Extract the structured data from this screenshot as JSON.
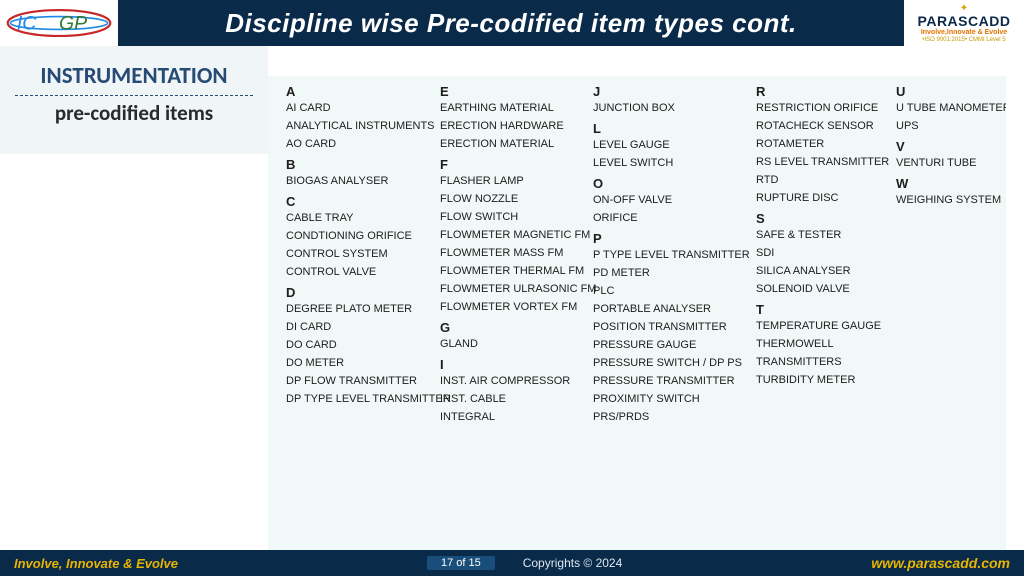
{
  "title": "Discipline wise Pre-codified item types cont.",
  "left_logo": {
    "text1": "IC",
    "text2": "GP"
  },
  "right_logo": {
    "brand": "PARASCADD",
    "tag1": "Involve,Innovate & Evolve",
    "tag2": "•ISO 9001:2015• CMMI Level 5"
  },
  "side": {
    "h1": "INSTRUMENTATION",
    "h2": "pre-codified items"
  },
  "columns": [
    [
      {
        "letter": "A",
        "items": [
          "AI CARD",
          "ANALYTICAL INSTRUMENTS",
          "AO CARD"
        ]
      },
      {
        "letter": "B",
        "items": [
          "BIOGAS ANALYSER"
        ]
      },
      {
        "letter": "C",
        "items": [
          "CABLE TRAY",
          "CONDTIONING ORIFICE",
          "CONTROL SYSTEM",
          "CONTROL VALVE"
        ]
      },
      {
        "letter": "D",
        "items": [
          "DEGREE PLATO METER",
          "DI CARD",
          "DO CARD",
          "DO METER",
          "DP FLOW TRANSMITTER",
          "DP TYPE LEVEL TRANSMITTER"
        ]
      }
    ],
    [
      {
        "letter": "E",
        "items": [
          "EARTHING MATERIAL",
          "ERECTION HARDWARE",
          "ERECTION MATERIAL"
        ]
      },
      {
        "letter": "F",
        "items": [
          "FLASHER LAMP",
          "FLOW NOZZLE",
          "FLOW SWITCH",
          "FLOWMETER MAGNETIC FM",
          "FLOWMETER MASS FM",
          "FLOWMETER THERMAL FM",
          "FLOWMETER ULRASONIC FM",
          "FLOWMETER VORTEX FM"
        ]
      },
      {
        "letter": "G",
        "items": [
          "GLAND"
        ]
      },
      {
        "letter": "I",
        "items": [
          "INST. AIR COMPRESSOR",
          "INST. CABLE",
          "INTEGRAL"
        ]
      }
    ],
    [
      {
        "letter": "J",
        "items": [
          "JUNCTION BOX"
        ]
      },
      {
        "letter": "L",
        "items": [
          "LEVEL GAUGE",
          "LEVEL SWITCH"
        ]
      },
      {
        "letter": "O",
        "items": [
          "ON-OFF VALVE",
          "ORIFICE"
        ]
      },
      {
        "letter": "P",
        "items": [
          "P TYPE LEVEL TRANSMITTER",
          "PD METER",
          "PLC",
          "PORTABLE ANALYSER",
          "POSITION TRANSMITTER",
          "PRESSURE GAUGE",
          "PRESSURE SWITCH / DP PS",
          "PRESSURE TRANSMITTER",
          "PROXIMITY SWITCH",
          "PRS/PRDS"
        ]
      }
    ],
    [
      {
        "letter": "R",
        "items": [
          "RESTRICTION ORIFICE",
          "ROTACHECK SENSOR",
          "ROTAMETER",
          "RS LEVEL TRANSMITTER",
          "RTD",
          "RUPTURE DISC"
        ]
      },
      {
        "letter": "S",
        "items": [
          "SAFE & TESTER",
          "SDI",
          "SILICA ANALYSER",
          "SOLENOID VALVE"
        ]
      },
      {
        "letter": "T",
        "items": [
          "TEMPERATURE GAUGE",
          "THERMOWELL",
          "TRANSMITTERS",
          "TURBIDITY METER"
        ]
      }
    ],
    [
      {
        "letter": "U",
        "items": [
          "U TUBE MANOMETER",
          "UPS"
        ]
      },
      {
        "letter": "V",
        "items": [
          "VENTURI TUBE"
        ]
      },
      {
        "letter": "W",
        "items": [
          "WEIGHING SYSTEM"
        ]
      }
    ]
  ],
  "footer": {
    "slogan": "Involve, Innovate & Evolve",
    "page": "17 of 15",
    "copy": "Copyrights © 2024",
    "url": "www.parascadd.com"
  }
}
